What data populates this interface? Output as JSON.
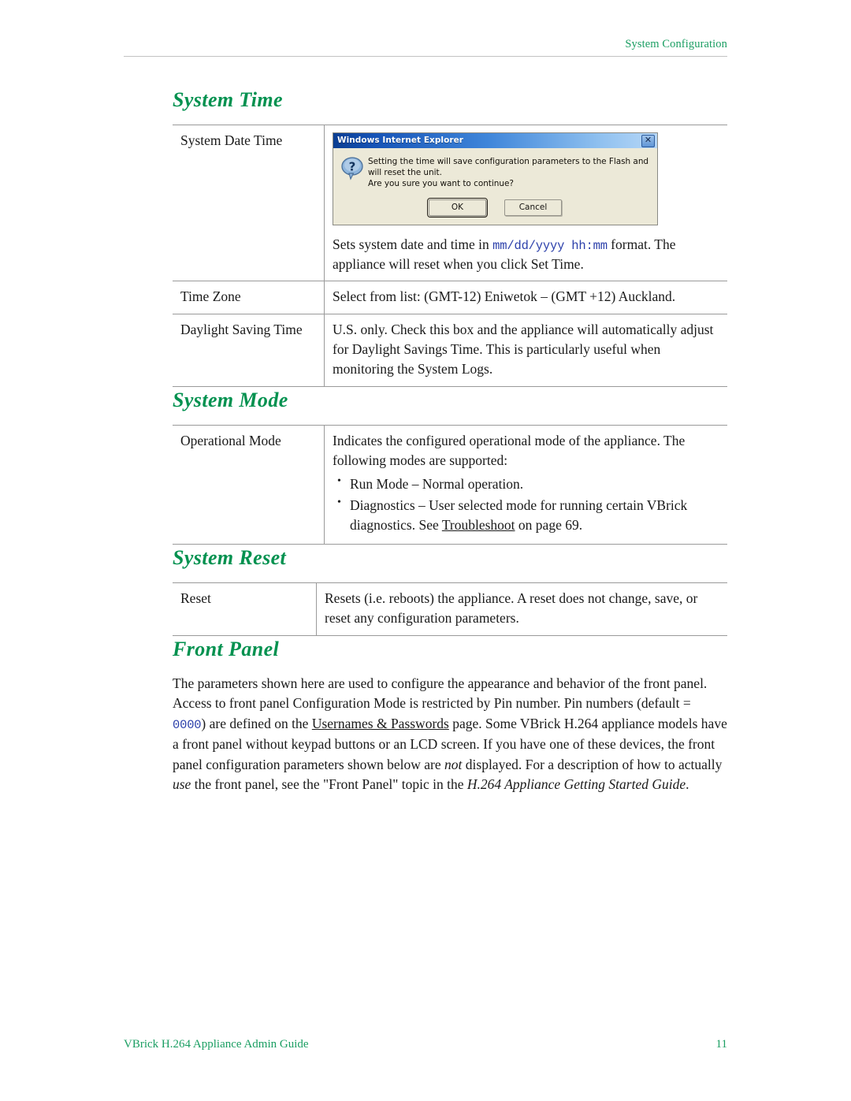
{
  "header": {
    "running_head": "System Configuration"
  },
  "sections": {
    "system_time": {
      "title": "System Time",
      "rows": [
        {
          "key": "System Date Time",
          "value_prefix": "Sets system date and time in ",
          "value_code": "mm/dd/yyyy hh:mm",
          "value_suffix": " format. The appliance will reset when you click Set Time."
        },
        {
          "key": "Time Zone",
          "value": "Select from list: (GMT-12) Eniwetok – (GMT +12) Auckland."
        },
        {
          "key": "Daylight Saving Time",
          "value": "U.S. only. Check this box and the appliance will automatically adjust for Daylight Savings Time. This is particularly useful when monitoring the System Logs."
        }
      ]
    },
    "system_mode": {
      "title": "System Mode",
      "key": "Operational Mode",
      "intro": "Indicates the configured operational mode of the appliance. The following modes are supported:",
      "bullets": [
        {
          "text": "Run Mode – Normal operation."
        },
        {
          "prefix": "Diagnostics – User selected mode for running certain VBrick diagnostics. See ",
          "xref": "Troubleshoot",
          "suffix": " on page 69."
        }
      ]
    },
    "system_reset": {
      "title": "System Reset",
      "key": "Reset",
      "value": "Resets (i.e. reboots) the appliance. A reset does not change, save, or reset any configuration parameters."
    },
    "front_panel": {
      "title": "Front Panel",
      "para_1": "The parameters shown here are used to configure the appearance and behavior of the front panel. Access to front panel Configuration Mode is restricted by Pin number. Pin numbers (default = ",
      "pin_default": "0000",
      "para_2": ") are defined on the ",
      "xref": "Usernames & Passwords",
      "para_3": " page. Some VBrick H.264 appliance models have a front panel without keypad buttons or an LCD screen. If you have one of these devices, the front panel configuration parameters shown below are ",
      "italic_not": "not",
      "para_4": " displayed. For a description of how to actually ",
      "italic_use": "use",
      "para_5": " the front panel, see the \"Front Panel\" topic in the ",
      "italic_guide": "H.264 Appliance Getting Started Guide",
      "para_6": "."
    }
  },
  "dialog": {
    "title": "Windows Internet Explorer",
    "close_glyph": "✕",
    "icon_glyph": "?",
    "message_line_1": "Setting the time will save configuration parameters to the Flash and will reset the unit.",
    "message_line_2": "Are you sure you want to continue?",
    "ok_label": "OK",
    "cancel_label": "Cancel"
  },
  "footer": {
    "doc_title": "VBrick H.264 Appliance Admin Guide",
    "page_number": "11"
  },
  "colors": {
    "heading_green": "#01914f",
    "header_footer_green": "#1a9e62",
    "code_blue": "#2b3faa",
    "rule_gray": "#9a9a9a"
  }
}
